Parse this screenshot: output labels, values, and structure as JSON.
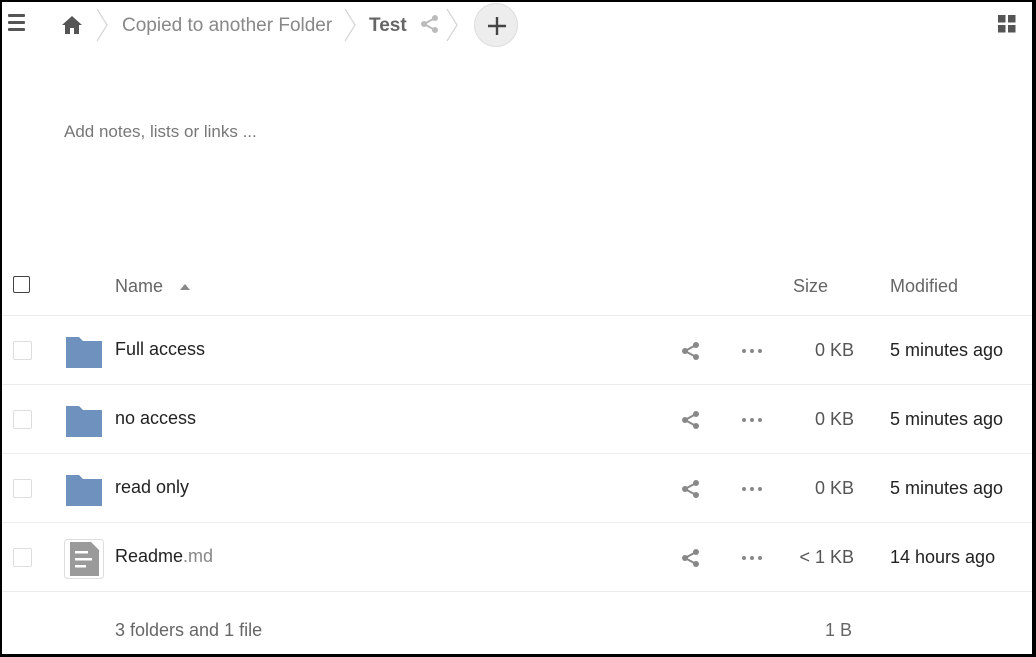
{
  "breadcrumb": {
    "items": [
      {
        "label": "Copied to another Folder"
      },
      {
        "label": "Test"
      }
    ]
  },
  "notes": {
    "placeholder": "Add notes, lists or links ..."
  },
  "table": {
    "columns": {
      "name": "Name",
      "size": "Size",
      "modified": "Modified"
    },
    "rows": [
      {
        "name": "Full access",
        "ext": "",
        "type": "folder",
        "size": "0 KB",
        "modified": "5 minutes ago"
      },
      {
        "name": "no access",
        "ext": "",
        "type": "folder",
        "size": "0 KB",
        "modified": "5 minutes ago"
      },
      {
        "name": "read only",
        "ext": "",
        "type": "folder",
        "size": "0 KB",
        "modified": "5 minutes ago"
      },
      {
        "name": "Readme",
        "ext": ".md",
        "type": "text-file",
        "size": "< 1 KB",
        "modified": "14 hours ago"
      }
    ],
    "summary": {
      "count": "3 folders and 1 file",
      "size": "1 B"
    }
  },
  "icons": {
    "menu": "hamburger-icon",
    "home": "home-icon",
    "share": "share-icon",
    "add": "plus-icon",
    "view": "grid-view-icon",
    "folder": "folder-icon",
    "file": "text-file-icon",
    "more": "more-dots-icon"
  },
  "colors": {
    "folder": "#6e91be",
    "file": "#9a9a9a",
    "accent": "#555555"
  }
}
